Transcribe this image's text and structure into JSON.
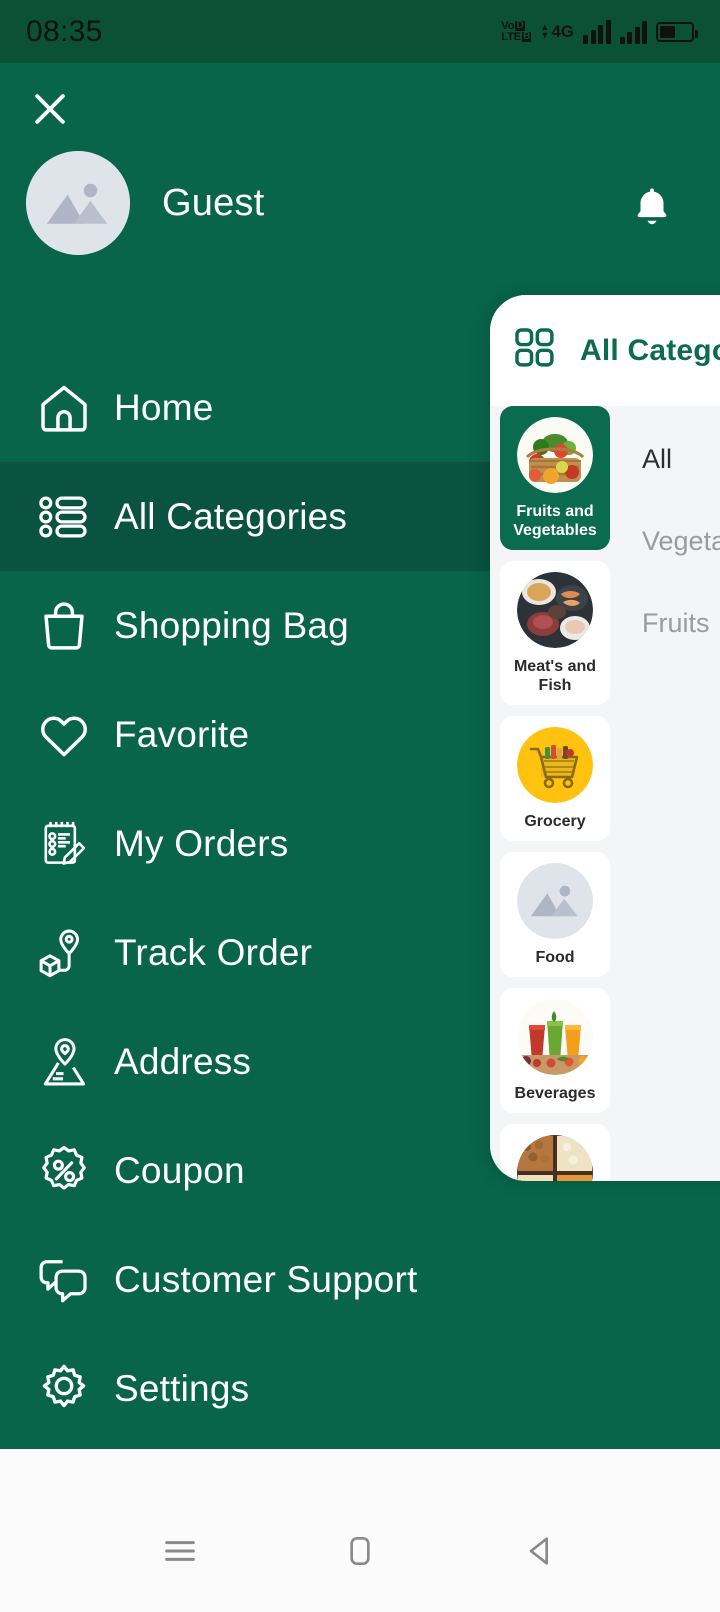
{
  "status_bar": {
    "time": "08:35",
    "volte_top": "Vo",
    "volte_top_box": "D",
    "volte_bottom": "LTE",
    "volte_bottom_box": "B",
    "network": "4G",
    "battery_level_pct": 45,
    "icons": [
      "volte-icon",
      "data-arrows-icon",
      "signal-bars-icon",
      "signal-bars-2-icon",
      "battery-icon"
    ]
  },
  "drawer": {
    "close_icon": "close-icon",
    "avatar_icon": "image-placeholder-icon",
    "user_name": "Guest",
    "bell_icon": "bell-icon",
    "items": [
      {
        "label": "Home",
        "icon": "home-icon",
        "active": false
      },
      {
        "label": "All Categories",
        "icon": "list-icon",
        "active": true
      },
      {
        "label": "Shopping Bag",
        "icon": "shopping-bag-icon",
        "active": false
      },
      {
        "label": "Favorite",
        "icon": "heart-icon",
        "active": false
      },
      {
        "label": "My Orders",
        "icon": "notepad-pencil-icon",
        "active": false
      },
      {
        "label": "Track Order",
        "icon": "package-location-icon",
        "active": false
      },
      {
        "label": "Address",
        "icon": "map-pin-icon",
        "active": false
      },
      {
        "label": "Coupon",
        "icon": "percent-badge-icon",
        "active": false
      },
      {
        "label": "Customer Support",
        "icon": "chat-bubbles-icon",
        "active": false
      },
      {
        "label": "Settings",
        "icon": "gear-icon",
        "active": false
      }
    ]
  },
  "categories_panel": {
    "header_icon": "grid-icon",
    "title": "All Categories",
    "tiles": [
      {
        "name": "Fruits and Vegetables",
        "thumb": "fruit-basket-photo",
        "selected": true
      },
      {
        "name": "Meat's and Fish",
        "thumb": "meat-fish-photo",
        "selected": false
      },
      {
        "name": "Grocery",
        "thumb": "grocery-cart-photo",
        "selected": false
      },
      {
        "name": "Food",
        "thumb": "image-placeholder",
        "selected": false
      },
      {
        "name": "Beverages",
        "thumb": "beverages-photo",
        "selected": false
      },
      {
        "name": "",
        "thumb": "dry-fruits-photo",
        "selected": false
      }
    ],
    "subcategories": [
      {
        "label": "All",
        "active": true
      },
      {
        "label": "Vegetables",
        "active": false
      },
      {
        "label": "Fruits",
        "active": false
      }
    ]
  },
  "navbar": {
    "recents_label": "recents-icon",
    "home_label": "home-square-icon",
    "back_label": "back-triangle-icon"
  },
  "colors": {
    "brand_green": "#08654a",
    "status_green": "#0a5138",
    "active_green": "#0a5340",
    "panel_bg": "#f4f5f7",
    "title_green": "#0d6b4f"
  }
}
